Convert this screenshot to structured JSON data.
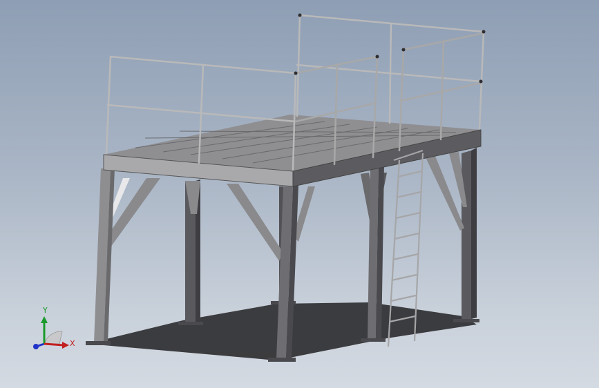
{
  "viewport": {
    "background_top": "#8e9eb4",
    "background_bottom": "#d4dae2"
  },
  "model": {
    "description_icon": "steel-platform-with-ladder-and-handrails",
    "steel_color": "#6f6f72",
    "steel_dark": "#4a4a4e",
    "steel_light": "#9a9a9c",
    "rail_color": "#b9b9b9",
    "shadow_color": "#2b2b2e"
  },
  "triad": {
    "x_label": "X",
    "y_label": "Y",
    "x_color": "#c22020",
    "y_color": "#1a9a2a",
    "z_color": "#1f33c8"
  }
}
